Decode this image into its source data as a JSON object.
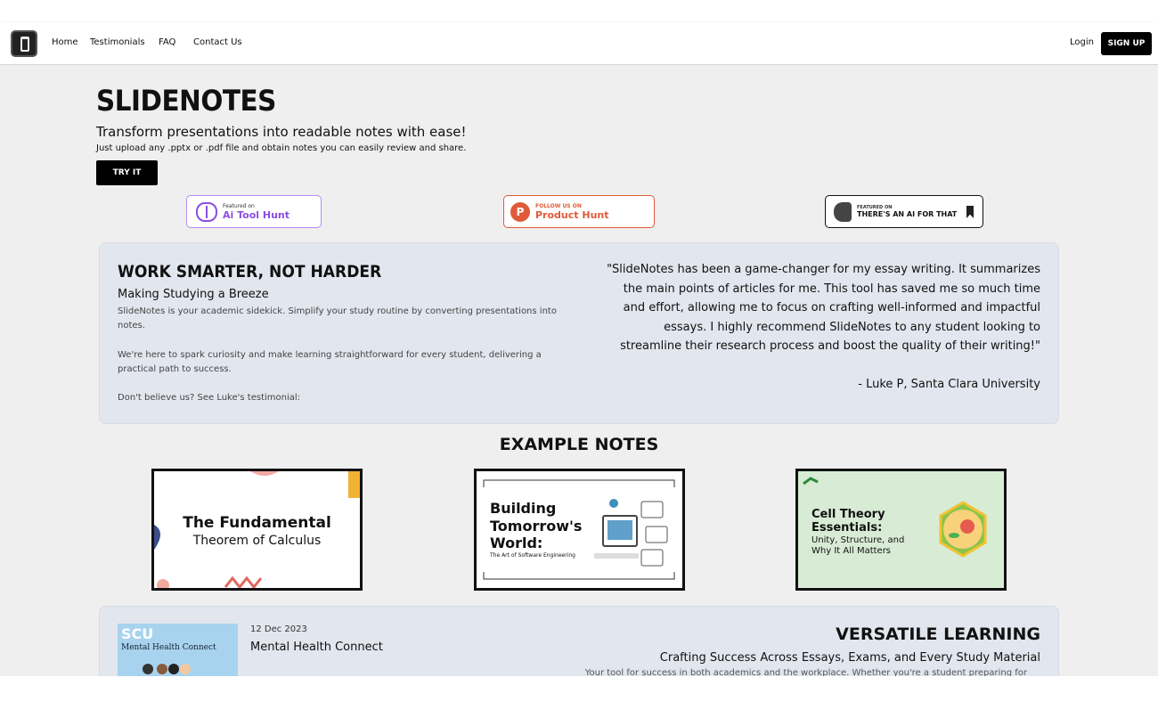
{
  "nav": {
    "links": [
      "Home",
      "Testimonials",
      "FAQ",
      "Contact Us"
    ],
    "login": "Login",
    "signup": "SIGN UP"
  },
  "hero": {
    "title": "SLIDENOTES",
    "subtitle": "Transform presentations into readable notes with ease!",
    "description": "Just upload any .pptx or .pdf file and obtain notes you can easily review and share.",
    "cta": "TRY IT"
  },
  "badges": {
    "ai_tool_hunt": {
      "small": "Featured on",
      "big": "Ai Tool Hunt",
      "icon": "brain-icon"
    },
    "product_hunt": {
      "small": "FOLLOW US ON",
      "big": "Product Hunt",
      "letter": "P"
    },
    "theres_an_ai": {
      "small": "FEATURED ON",
      "big": "THERE'S AN AI FOR THAT",
      "icon": "muscle-arm-icon"
    }
  },
  "about": {
    "title": "WORK SMARTER, NOT HARDER",
    "subtitle": "Making Studying a Breeze",
    "para1": "SlideNotes is your academic sidekick. Simplify your study routine by converting presentations into notes.",
    "para2": "We're here to spark curiosity and make learning straightforward for every student, delivering a practical path to success.",
    "para3": "Don't believe us? See Luke's testimonial:",
    "quote": "\"SlideNotes has been a game-changer for my essay writing. It summarizes the main points of articles for me. This tool has saved me so much time and effort, allowing me to focus on crafting well-informed and impactful essays. I highly recommend SlideNotes to any student looking to streamline their research process and boost the quality of their writing!\"",
    "author": "- Luke P, Santa Clara University"
  },
  "examples": {
    "title": "EXAMPLE NOTES",
    "items": [
      {
        "title": "The Fundamental",
        "subtitle": "Theorem of Calculus"
      },
      {
        "title": "Building Tomorrow's World:",
        "subtitle": "The Art of Software Engineering"
      },
      {
        "title": "Cell Theory Essentials:",
        "subtitle": "Unity, Structure, and Why It All Matters"
      }
    ]
  },
  "notes": {
    "thumb_logo": "SCU",
    "thumb_title": "Mental Health Connect",
    "date": "12 Dec 2023",
    "title": "Mental Health Connect"
  },
  "versatile": {
    "title": "VERSATILE LEARNING",
    "subtitle": "Crafting Success Across Essays, Exams, and Every Study Material",
    "description": "Your tool for success in both academics and the workplace. Whether you're a student preparing for"
  },
  "colors": {
    "accent_purple": "#8a4fe0",
    "product_hunt": "#e05a3a",
    "card_bg": "#e2e6ee",
    "page_bg": "#efefef"
  }
}
